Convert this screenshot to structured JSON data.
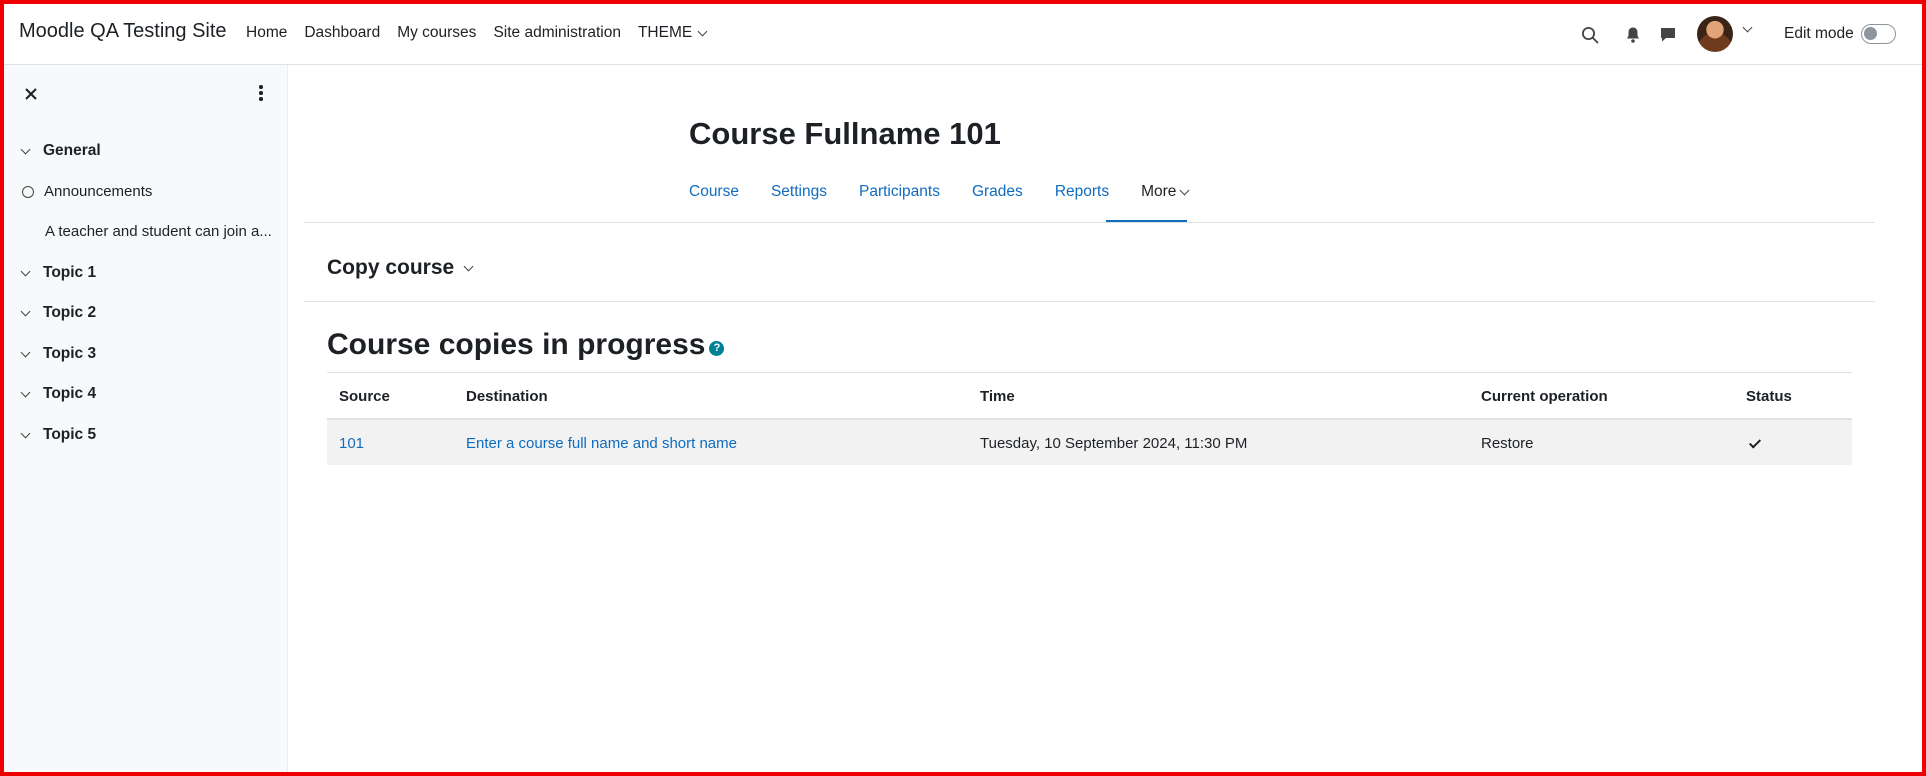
{
  "site": {
    "brand": "Moodle QA Testing Site"
  },
  "primary_nav": [
    "Home",
    "Dashboard",
    "My courses",
    "Site administration",
    "THEME"
  ],
  "user_menu": {
    "edit_mode_label": "Edit mode",
    "edit_mode_on": false
  },
  "sidebar": {
    "sections": [
      {
        "label": "General",
        "items": [
          "Announcements",
          "A teacher and student can join a..."
        ]
      },
      {
        "label": "Topic 1"
      },
      {
        "label": "Topic 2"
      },
      {
        "label": "Topic 3"
      },
      {
        "label": "Topic 4"
      },
      {
        "label": "Topic 5"
      }
    ]
  },
  "course": {
    "title": "Course Fullname 101",
    "tabs": [
      "Course",
      "Settings",
      "Participants",
      "Grades",
      "Reports",
      "More"
    ],
    "active_tab": "More"
  },
  "page": {
    "action_heading": "Copy course",
    "section_heading": "Course copies in progress",
    "help_icon": "?"
  },
  "table": {
    "headers": [
      "Source",
      "Destination",
      "Time",
      "Current operation",
      "Status"
    ],
    "rows": [
      {
        "source": "101",
        "destination": "Enter a course full name and short name",
        "time": "Tuesday, 10 September 2024, 11:30 PM",
        "operation": "Restore",
        "status_icon": "check-icon"
      }
    ]
  },
  "colors": {
    "link": "#0f6cbf",
    "frame": "#ee0000",
    "help": "#008196"
  }
}
